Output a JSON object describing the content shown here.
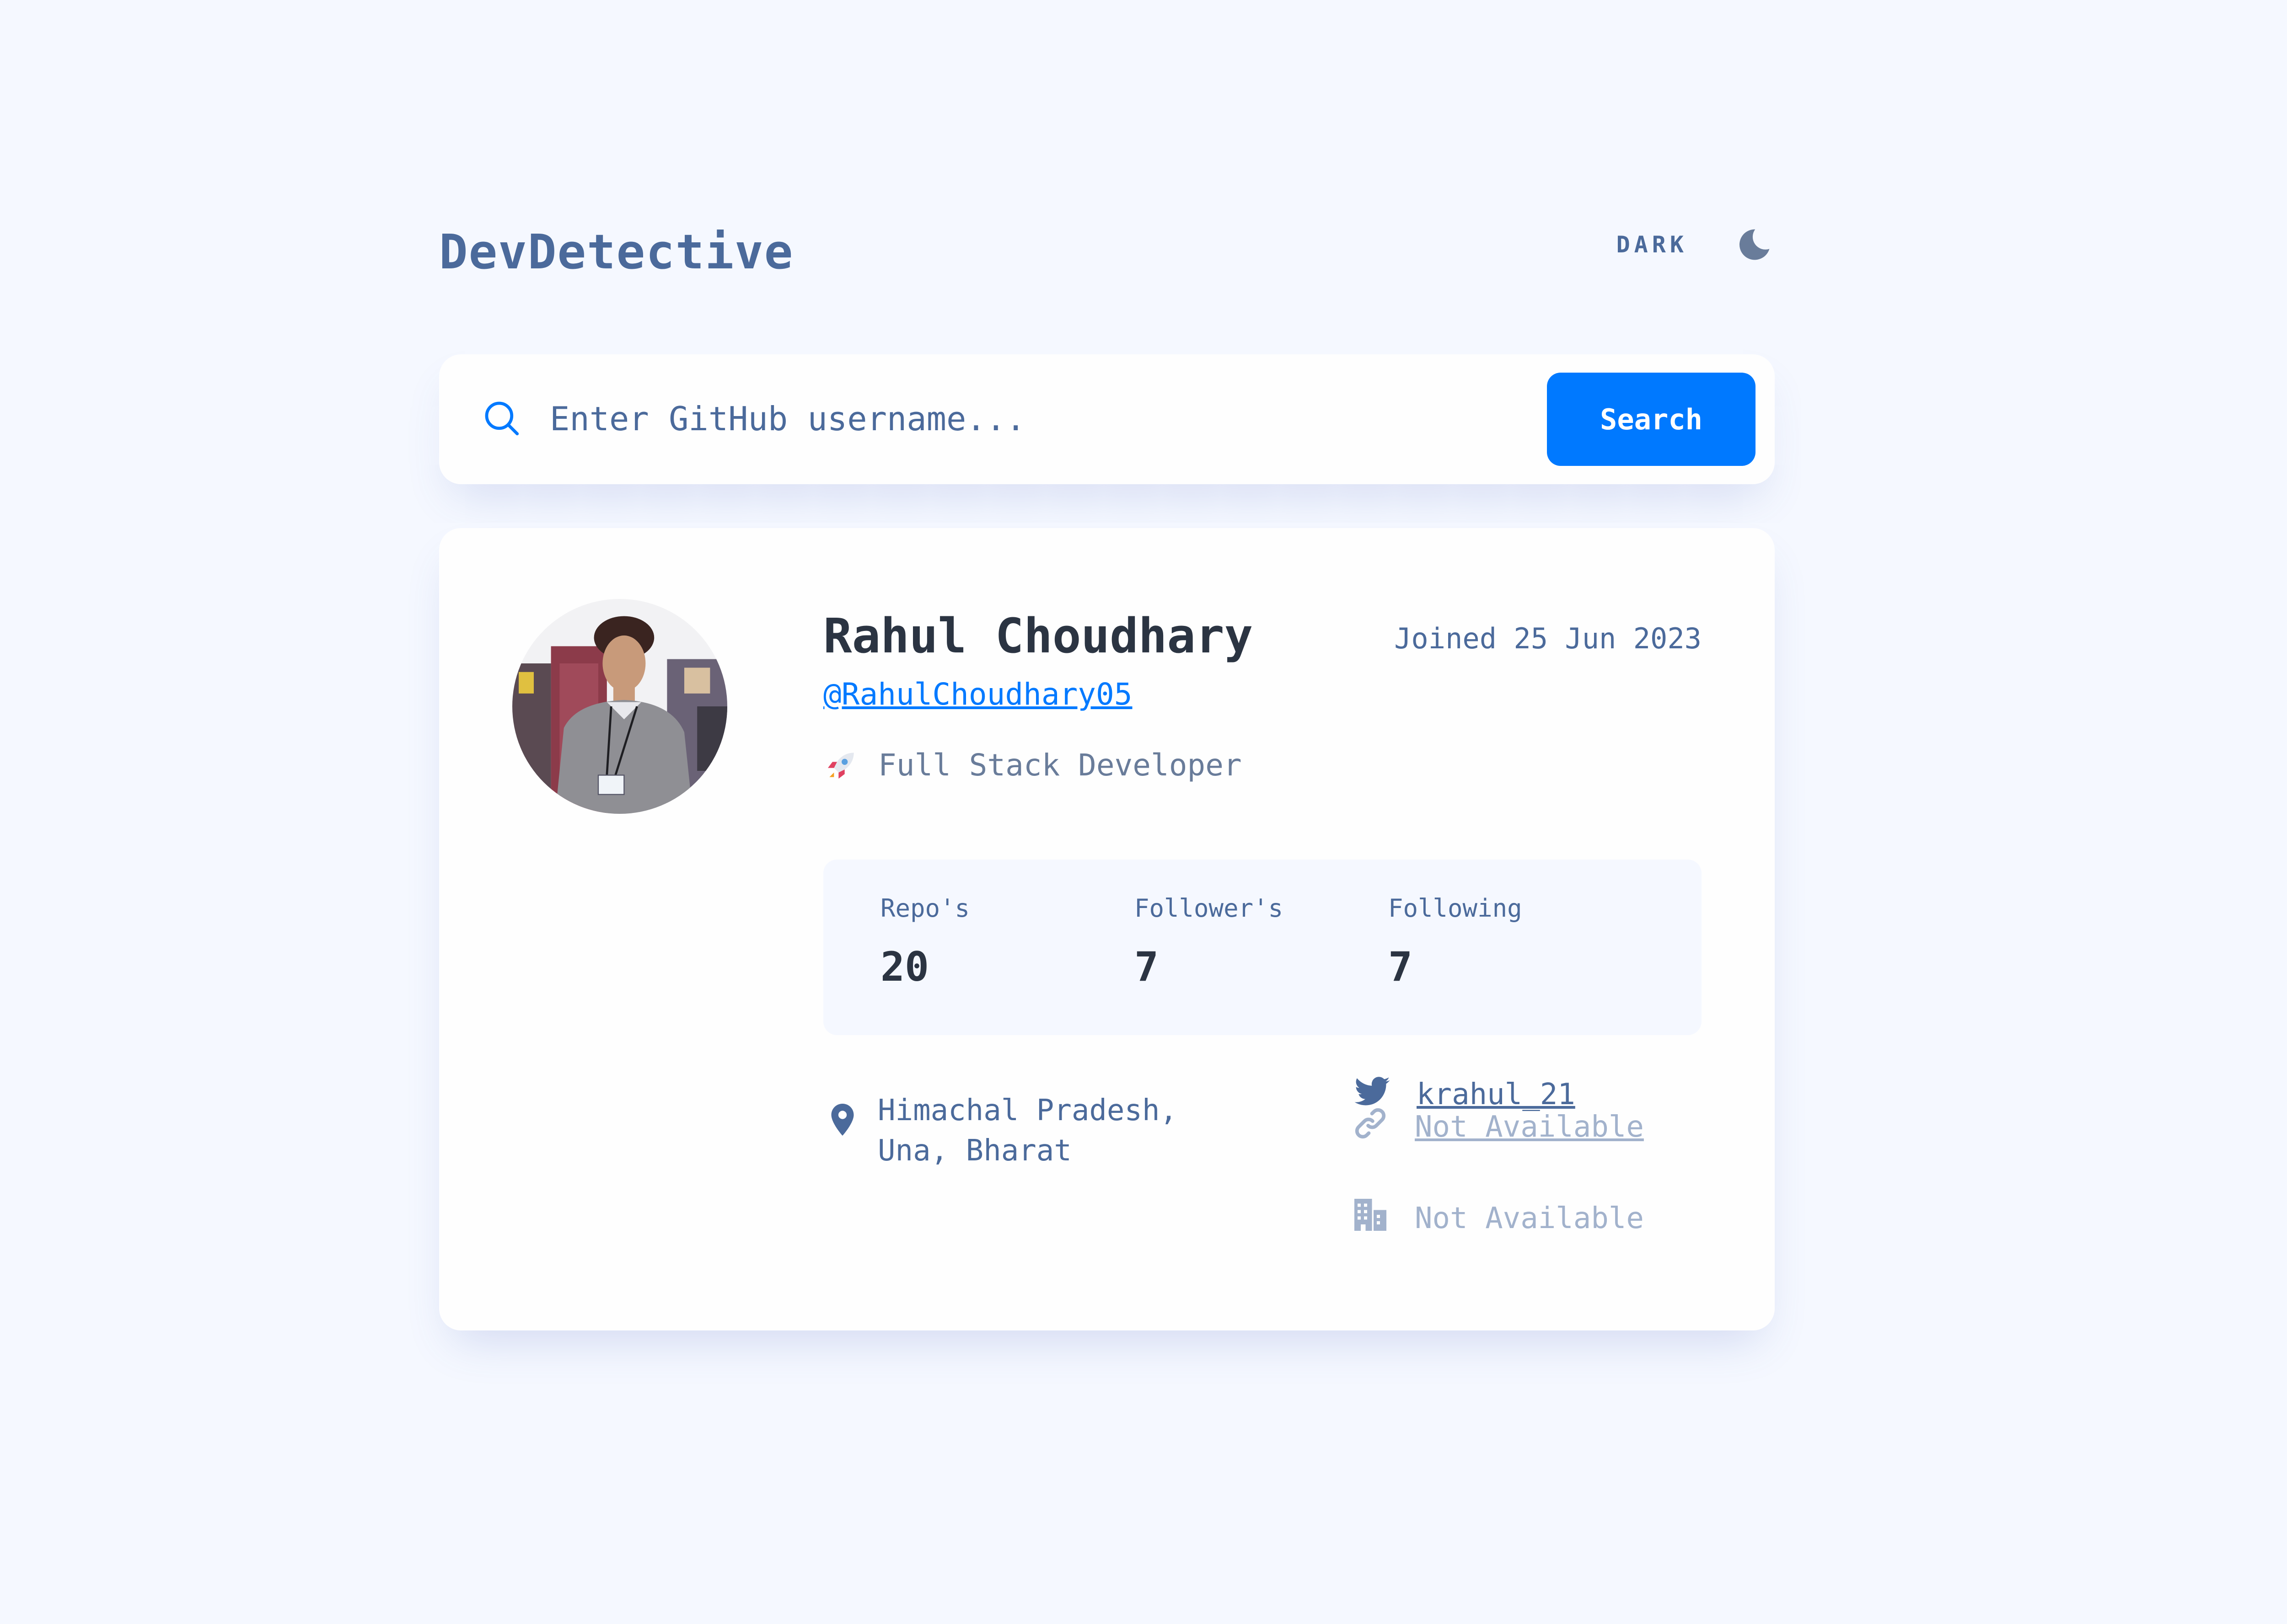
{
  "header": {
    "logo": "DevDetective",
    "theme_toggle_label": "DARK",
    "theme_icon": "moon-icon"
  },
  "search": {
    "icon": "search-icon",
    "placeholder": "Enter GitHub username...",
    "value": "",
    "button_label": "Search"
  },
  "profile": {
    "name": "Rahul Choudhary",
    "handle": "@RahulChoudhary05",
    "joined": "Joined 25 Jun 2023",
    "bio_icon": "rocket-icon",
    "bio": "Full Stack Developer",
    "stats": [
      {
        "label": "Repo's",
        "value": "20"
      },
      {
        "label": "Follower's",
        "value": "7"
      },
      {
        "label": "Following",
        "value": "7"
      }
    ],
    "links": {
      "location_line1": "Himachal Pradesh,",
      "location_line2": "Una, Bharat",
      "website": "Not Available",
      "twitter": "krahul_21",
      "company": "Not Available"
    }
  },
  "colors": {
    "background": "#f5f8ff",
    "card": "#fefefe",
    "accent": "#0079ff",
    "text_primary": "#2b3442",
    "text_secondary": "#4b6a9b",
    "text_muted": "#a2b2cc"
  }
}
